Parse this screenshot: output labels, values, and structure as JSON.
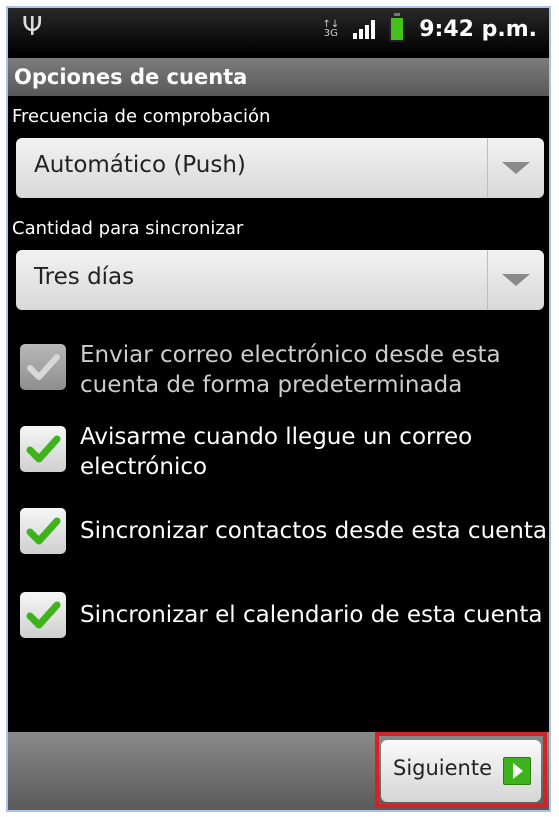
{
  "status_bar": {
    "usb_icon": "usb-icon",
    "network_label": "3G",
    "signal_icon": "signal-icon",
    "battery_icon": "battery-icon",
    "time": "9:42 p.m."
  },
  "title": "Opciones de cuenta",
  "check_frequency": {
    "label": "Frecuencia de comprobación",
    "value": "Automático (Push)"
  },
  "sync_amount": {
    "label": "Cantidad para sincronizar",
    "value": "Tres días"
  },
  "options": [
    {
      "label": "Enviar correo electrónico desde esta cuenta de forma predeterminada",
      "checked": true,
      "enabled": false
    },
    {
      "label": "Avisarme cuando llegue un correo electrónico",
      "checked": true,
      "enabled": true
    },
    {
      "label": "Sincronizar contactos desde esta cuenta",
      "checked": true,
      "enabled": true
    },
    {
      "label": "Sincronizar el calendario de esta cuenta",
      "checked": true,
      "enabled": true
    }
  ],
  "next_button": {
    "label": "Siguiente",
    "icon": "arrow-right-icon"
  },
  "colors": {
    "check_green": "#3fb31b",
    "highlight_red": "#d3222a"
  }
}
